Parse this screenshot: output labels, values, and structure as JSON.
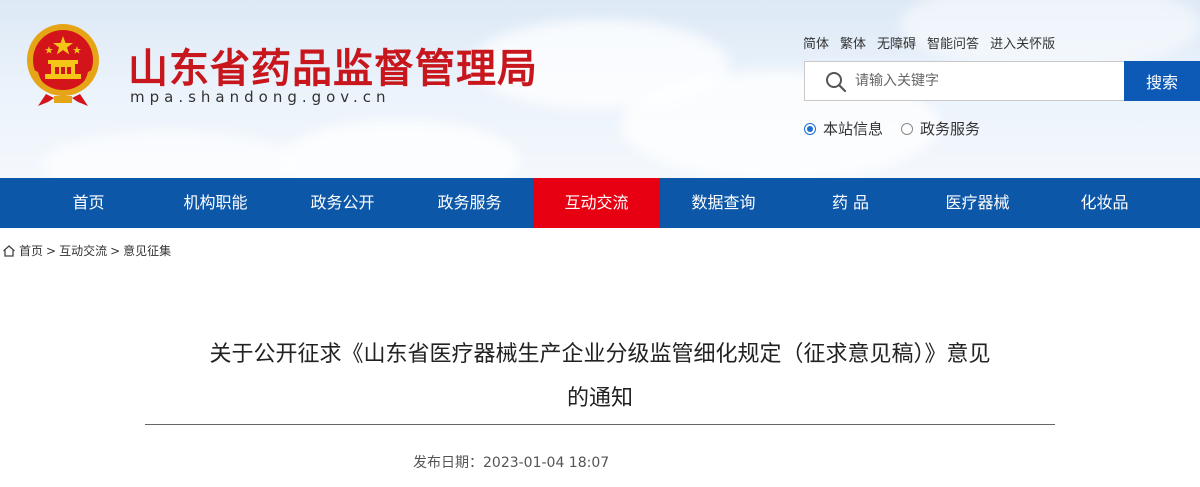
{
  "header": {
    "title": "山东省药品监督管理局",
    "domain": "mpa.shandong.gov.cn",
    "top_links": [
      "简体",
      "繁体",
      "无障碍",
      "智能问答",
      "进入关怀版"
    ],
    "search": {
      "placeholder": "请输入关键字",
      "button": "搜索"
    },
    "scope_options": [
      {
        "label": "本站信息",
        "selected": true
      },
      {
        "label": "政务服务",
        "selected": false
      }
    ]
  },
  "nav": {
    "items": [
      "首页",
      "机构职能",
      "政务公开",
      "政务服务",
      "互动交流",
      "数据查询",
      "药 品",
      "医疗器械",
      "化妆品"
    ],
    "active_index": 4
  },
  "breadcrumb": {
    "items": [
      "首页",
      "互动交流",
      "意见征集"
    ],
    "separator": ">"
  },
  "article": {
    "title_line1": "关于公开征求《山东省医疗器械生产企业分级监管细化规定（征求意见稿）》意见",
    "title_line2": "的通知",
    "publish_label": "发布日期：",
    "publish_date": "2023-01-04 18:07"
  },
  "colors": {
    "title_red": "#c8161d",
    "nav_blue": "#0d57a8",
    "nav_active_red": "#e60012",
    "search_button_blue": "#0d5ab6"
  }
}
